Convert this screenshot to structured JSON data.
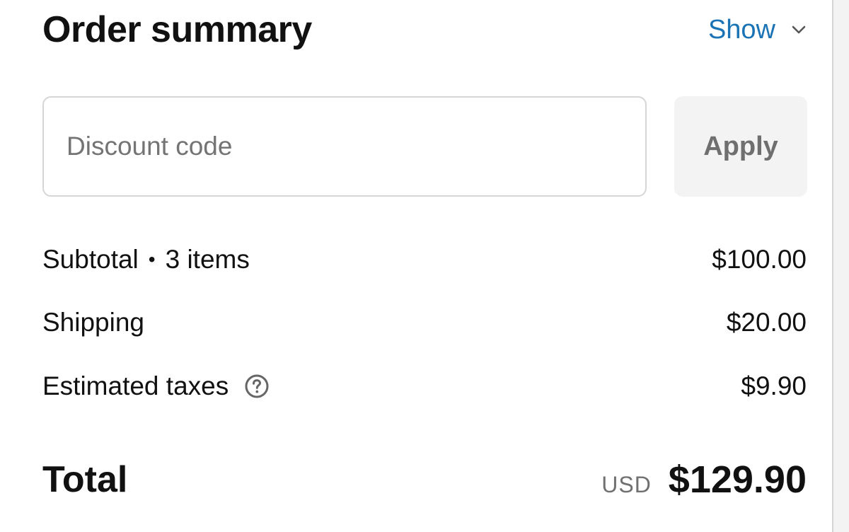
{
  "summary": {
    "title": "Order summary",
    "toggle_label": "Show",
    "toggle_icon": "chevron-down-icon"
  },
  "discount": {
    "placeholder": "Discount code",
    "value": "",
    "apply_label": "Apply"
  },
  "lines": {
    "subtotal": {
      "label": "Subtotal",
      "separator": "•",
      "items": "3 items",
      "amount": "$100.00"
    },
    "shipping": {
      "label": "Shipping",
      "amount": "$20.00"
    },
    "taxes": {
      "label": "Estimated taxes",
      "icon": "help-circle-icon",
      "amount": "$9.90"
    }
  },
  "total": {
    "label": "Total",
    "currency": "USD",
    "amount": "$129.90"
  },
  "colors": {
    "link": "#1a73b5",
    "text": "#111111",
    "muted": "#707070",
    "button_bg": "#f3f3f3",
    "border": "#d6d6d6"
  }
}
